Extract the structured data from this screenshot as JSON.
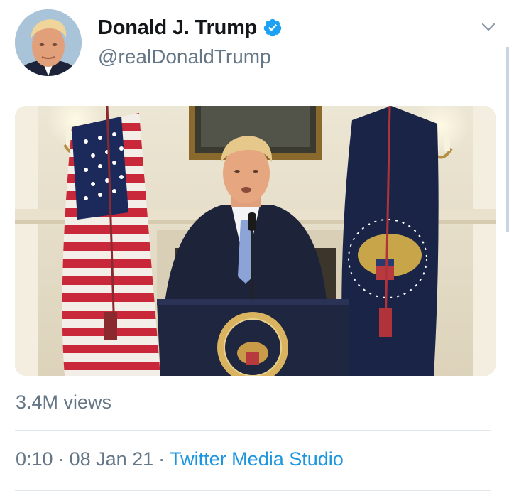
{
  "tweet": {
    "display_name": "Donald J. Trump",
    "handle": "@realDonaldTrump",
    "verified": true,
    "views": "3.4M views",
    "video_duration": "0:10",
    "separator": "·",
    "date": "08 Jan 21",
    "source": "Twitter Media Studio"
  },
  "icons": {
    "verified": "verified-badge-icon",
    "more_options": "chevron-down-icon"
  },
  "colors": {
    "verified_blue": "#1da1f2",
    "link_blue": "#1b95e0",
    "secondary_text": "#657786",
    "primary_text": "#14171a",
    "divider": "#e1e8ed"
  }
}
